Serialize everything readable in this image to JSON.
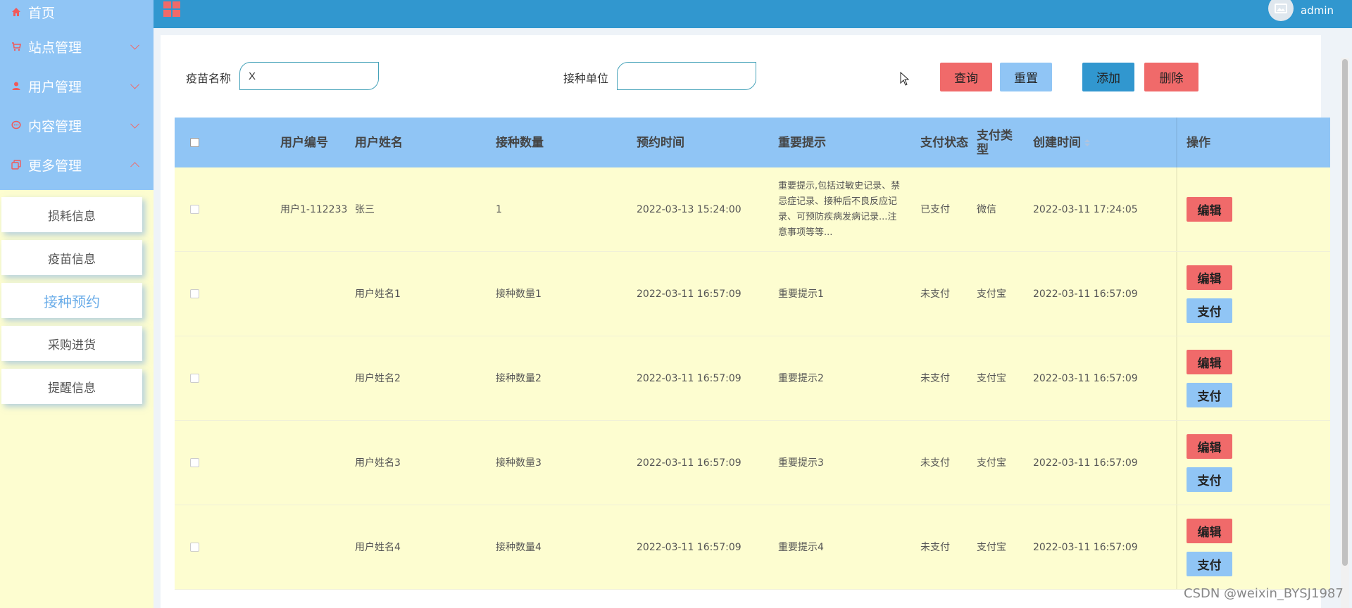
{
  "sidebar": {
    "home": "首页",
    "menus": [
      "站点管理",
      "用户管理",
      "内容管理",
      "更多管理"
    ],
    "submenu": [
      "损耗信息",
      "疫苗信息",
      "接种预约",
      "采购进货",
      "提醒信息"
    ]
  },
  "topbar": {
    "username": "admin"
  },
  "search": {
    "vaccine_label": "疫苗名称",
    "vaccine_value": "X",
    "unit_label": "接种单位",
    "unit_value": ""
  },
  "buttons": {
    "query": "查询",
    "reset": "重置",
    "add": "添加",
    "delete": "删除"
  },
  "table": {
    "headers": [
      "用户编号",
      "用户姓名",
      "接种数量",
      "预约时间",
      "重要提示",
      "支付状态",
      "支付类型",
      "创建时间",
      "操作"
    ],
    "rows": [
      {
        "id": "用户1-112233",
        "name": "张三",
        "qty": "1",
        "time": "2022-03-13 15:24:00",
        "tip": "重要提示,包括过敏史记录、禁忌症记录、接种后不良反应记录、可预防疾病发病记录...注意事项等等...",
        "pay": "已支付",
        "ptype": "微信",
        "ctime": "2022-03-11 17:24:05"
      },
      {
        "id": "",
        "name": "用户姓名1",
        "qty": "接种数量1",
        "time": "2022-03-11 16:57:09",
        "tip": "重要提示1",
        "pay": "未支付",
        "ptype": "支付宝",
        "ctime": "2022-03-11 16:57:09"
      },
      {
        "id": "",
        "name": "用户姓名2",
        "qty": "接种数量2",
        "time": "2022-03-11 16:57:09",
        "tip": "重要提示2",
        "pay": "未支付",
        "ptype": "支付宝",
        "ctime": "2022-03-11 16:57:09"
      },
      {
        "id": "",
        "name": "用户姓名3",
        "qty": "接种数量3",
        "time": "2022-03-11 16:57:09",
        "tip": "重要提示3",
        "pay": "未支付",
        "ptype": "支付宝",
        "ctime": "2022-03-11 16:57:09"
      },
      {
        "id": "",
        "name": "用户姓名4",
        "qty": "接种数量4",
        "time": "2022-03-11 16:57:09",
        "tip": "重要提示4",
        "pay": "未支付",
        "ptype": "支付宝",
        "ctime": "2022-03-11 16:57:09"
      }
    ],
    "edit_label": "编辑",
    "pay_label": "支付"
  },
  "watermark": "CSDN @weixin_BYSJ1987",
  "colors": {
    "sidebar_bg": "#90c5f5",
    "topbar": "#3197cf",
    "accent_red": "#f06a6a",
    "row_bg": "#fdfdd0"
  }
}
